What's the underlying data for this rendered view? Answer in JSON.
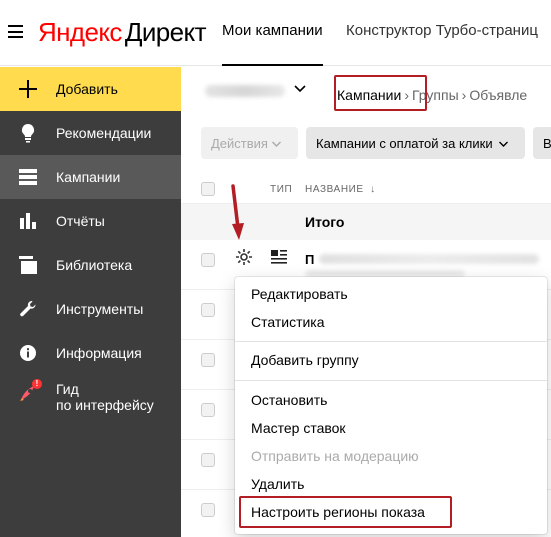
{
  "header": {
    "logo_brand": "Яндекс",
    "logo_product": "Директ",
    "tabs": [
      {
        "label": "Мои кампании",
        "active": true
      },
      {
        "label": "Конструктор Турбо-страниц",
        "active": false
      }
    ]
  },
  "sidebar": {
    "items": [
      {
        "label": "Добавить",
        "icon": "plus-icon"
      },
      {
        "label": "Рекомендации",
        "icon": "lightbulb-icon"
      },
      {
        "label": "Кампании",
        "icon": "list-icon",
        "active": true
      },
      {
        "label": "Отчёты",
        "icon": "bar-chart-icon"
      },
      {
        "label": "Библиотека",
        "icon": "library-icon"
      },
      {
        "label": "Инструменты",
        "icon": "wrench-icon"
      },
      {
        "label": "Информация",
        "icon": "info-icon"
      },
      {
        "label_line1": "Гид",
        "label_line2": "по интерфейсу",
        "icon": "rocket-icon",
        "badge": "!"
      }
    ],
    "colors": {
      "bg": "#3d3d3d",
      "add_bg": "#ffdb4d",
      "active_bg": "#595959"
    }
  },
  "breadcrumbs": {
    "items": [
      "Кампании",
      "Группы",
      "Объявле"
    ],
    "highlight_color": "#b31e24"
  },
  "toolbar": {
    "actions_label": "Действия",
    "filter_label": "Кампании с оплатой за клики",
    "more_label": "В"
  },
  "table": {
    "col_type": "ТИП",
    "col_name": "НАЗВАНИЕ",
    "sort_glyph": "↓",
    "total_label": "Итого",
    "first_row_name_initial": "П"
  },
  "context_menu": {
    "items": [
      {
        "label": "Редактировать",
        "disabled": false
      },
      {
        "label": "Статистика",
        "disabled": false
      },
      {
        "label": "Добавить группу",
        "disabled": false
      },
      {
        "label": "Остановить",
        "disabled": false
      },
      {
        "label": "Мастер ставок",
        "disabled": false
      },
      {
        "label": "Отправить на модерацию",
        "disabled": true
      },
      {
        "label": "Удалить",
        "disabled": false
      },
      {
        "label": "Настроить регионы показа",
        "disabled": false,
        "highlighted": true
      }
    ]
  }
}
